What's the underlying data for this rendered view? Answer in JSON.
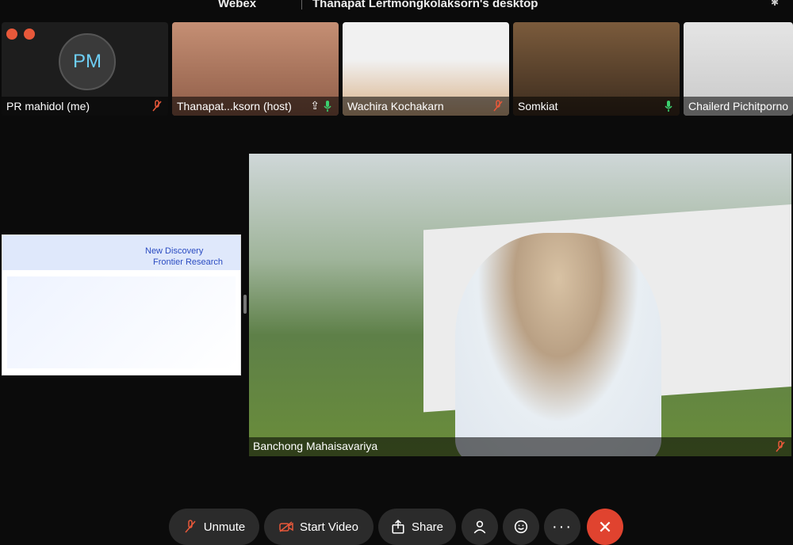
{
  "titlebar": {
    "app_name": "Webex",
    "sharing_title": "Thanapat Lertmongkolaksorn's desktop"
  },
  "participants": [
    {
      "name": "PR mahidol (me)",
      "initials": "PM",
      "mic": "muted"
    },
    {
      "name": "Thanapat...ksorn (host)",
      "mic": "on",
      "sharing": true
    },
    {
      "name": "Wachira Kochakarn",
      "mic": "muted"
    },
    {
      "name": "Somkiat",
      "mic": "on"
    },
    {
      "name": "Chailerd Pichitporno",
      "mic": "on"
    }
  ],
  "shared_slide": {
    "title_line1": "New Discovery",
    "title_line2": "Frontier Research"
  },
  "active_speaker": {
    "name": "Banchong Mahaisavariya",
    "mic": "muted"
  },
  "controls": {
    "unmute_label": "Unmute",
    "start_video_label": "Start Video",
    "share_label": "Share"
  },
  "colors": {
    "accent_red": "#e0432f",
    "mic_on": "#3bd16f",
    "mic_off": "#e8583a"
  }
}
